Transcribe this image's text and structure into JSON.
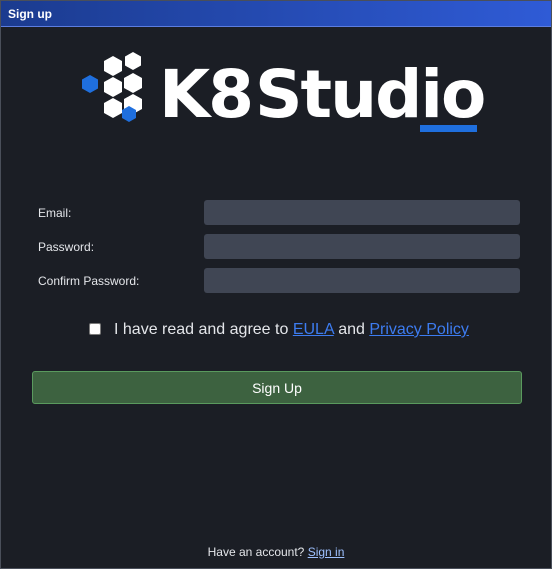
{
  "window": {
    "title": "Sign up"
  },
  "logo": {
    "text_k8": "K8",
    "text_studio": "Studio",
    "accent_color": "#1f6fde",
    "text_color": "#ffffff"
  },
  "form": {
    "email_label": "Email:",
    "email_value": "",
    "password_label": "Password:",
    "password_value": "",
    "confirm_label": "Confirm Password:",
    "confirm_value": ""
  },
  "agreement": {
    "checked": false,
    "prefix": "I have read and agree to",
    "eula_link": "EULA",
    "connector": "and",
    "privacy_link": "Privacy Policy"
  },
  "signup_button": {
    "label": "Sign Up",
    "color": "#3d6240"
  },
  "footer": {
    "prompt": "Have an account?",
    "signin_link": "Sign in"
  }
}
